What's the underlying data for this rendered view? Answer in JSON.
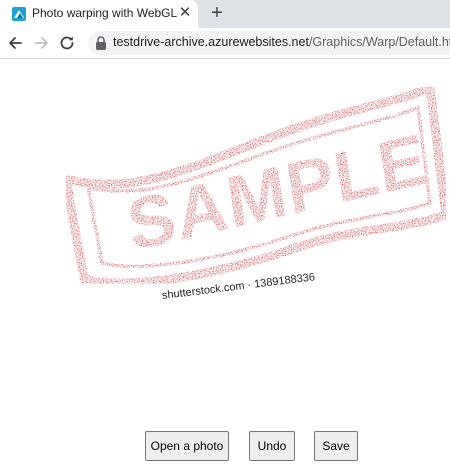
{
  "browser": {
    "tab": {
      "title": "Photo warping with WebGL",
      "close_icon": "close-icon"
    },
    "new_tab_icon": "plus-icon",
    "nav": {
      "back_icon": "arrow-left-icon",
      "forward_icon": "arrow-right-icon",
      "reload_icon": "reload-icon",
      "lock_icon": "lock-icon"
    },
    "url": {
      "host": "testdrive-archive.azurewebsites.net",
      "path": "/Graphics/Warp/Default.html"
    }
  },
  "content": {
    "stamp_text": "SAMPLE",
    "watermark": "shutterstock.com · 1389188336",
    "stamp_color": "#c4161c"
  },
  "actions": {
    "open_label": "Open a photo",
    "undo_label": "Undo",
    "save_label": "Save"
  }
}
